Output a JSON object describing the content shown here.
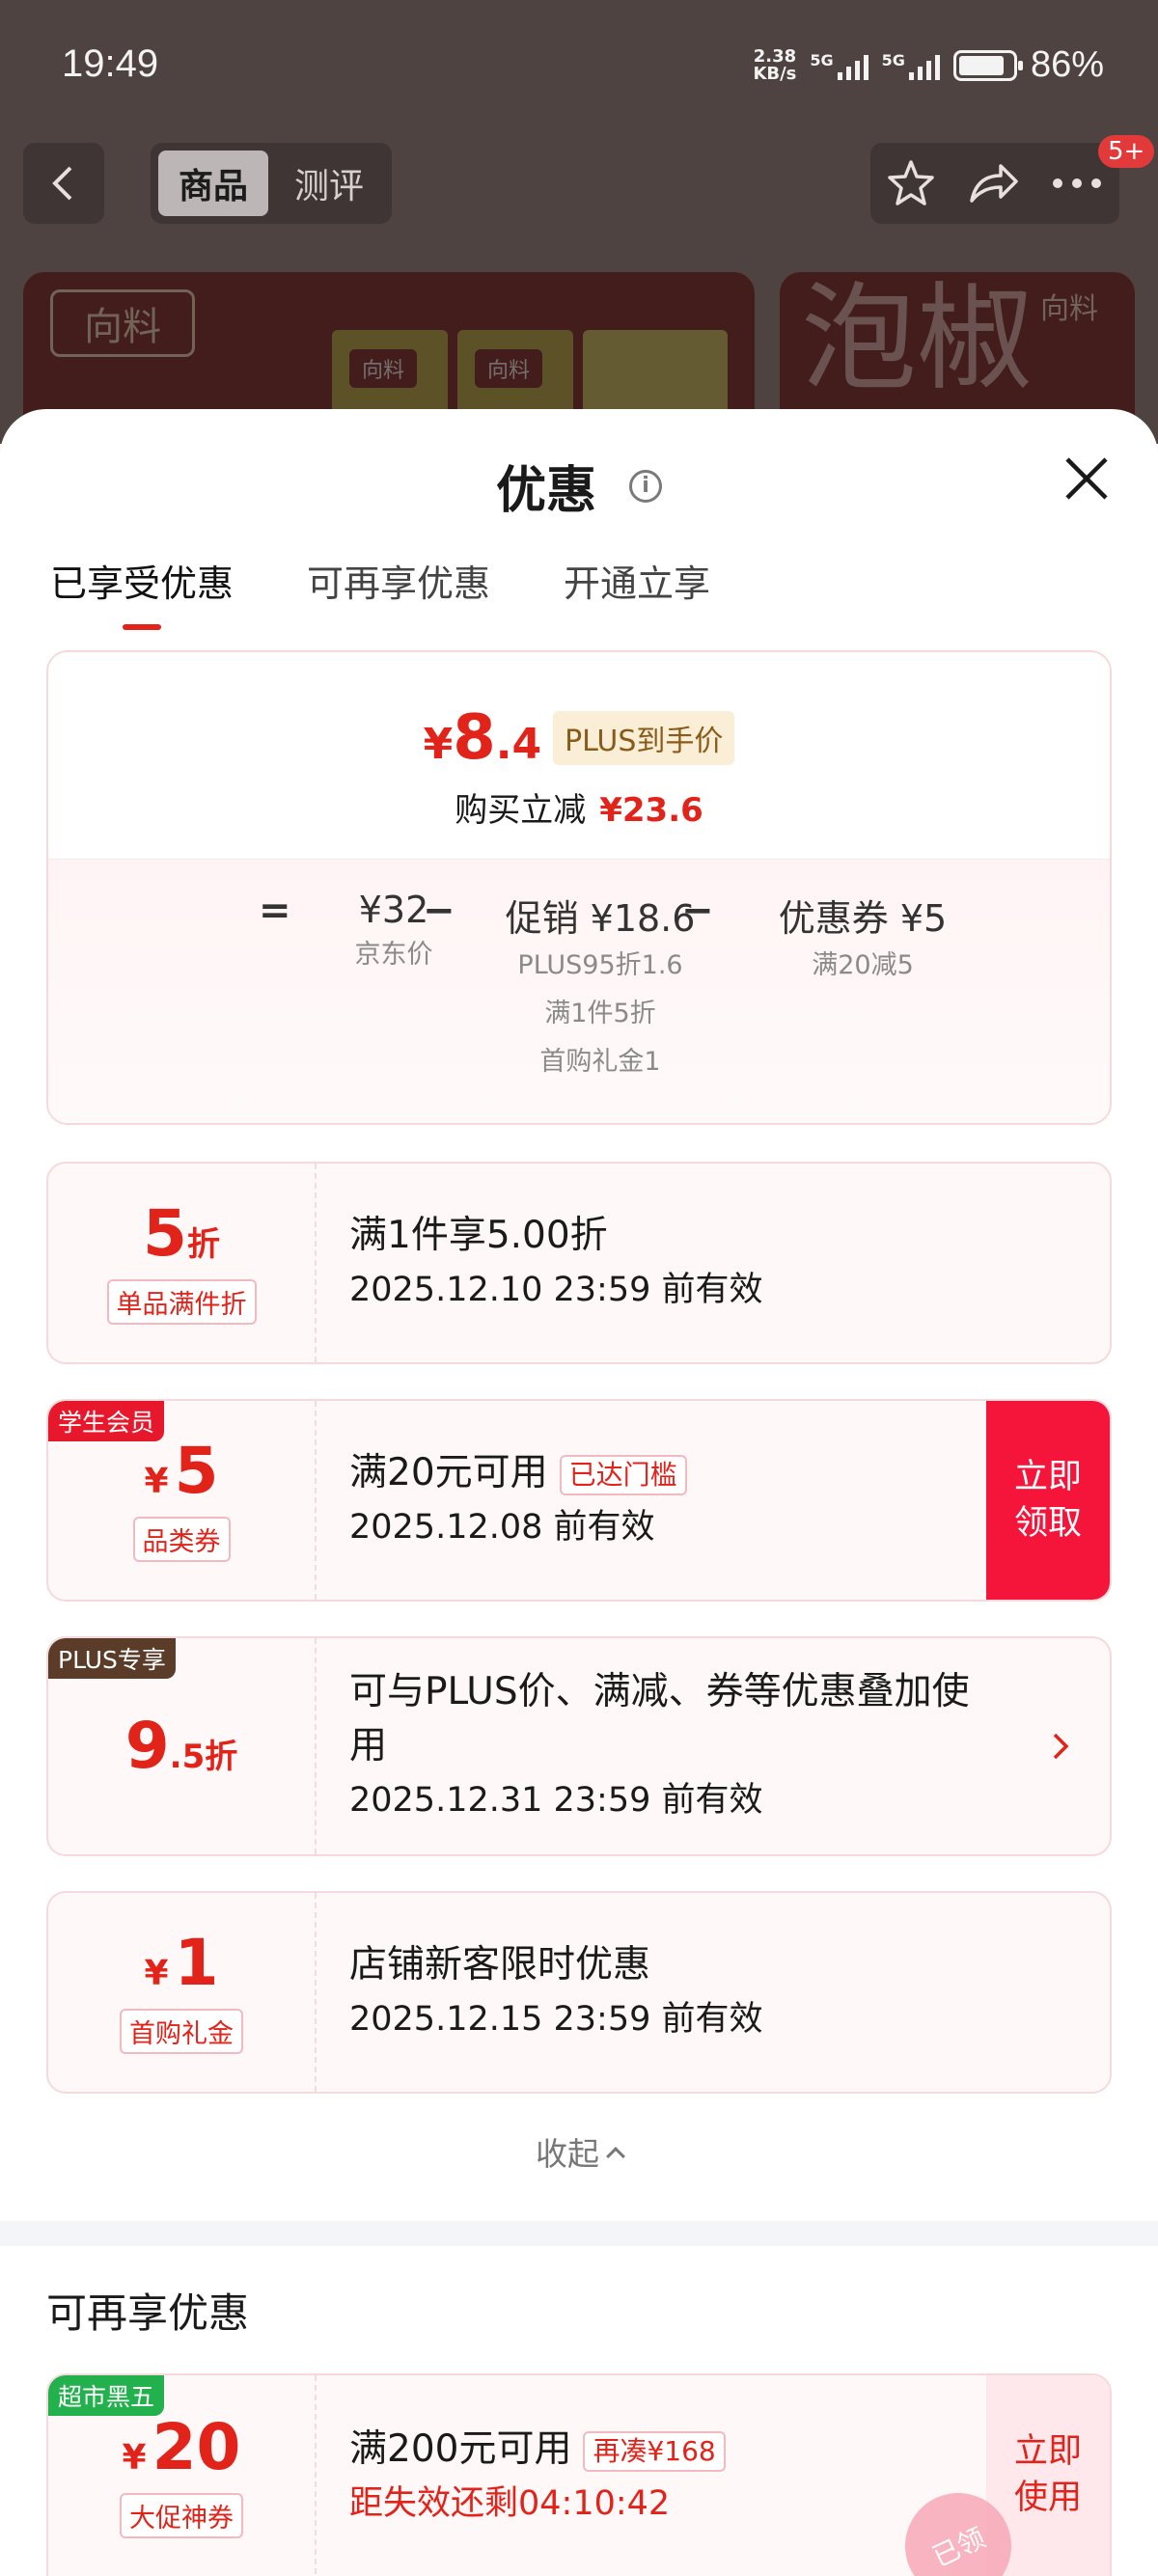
{
  "status_bar": {
    "time": "19:49",
    "net_speed_value": "2.38",
    "net_speed_unit": "KB/s",
    "sig1_label": "5G",
    "sig2_label": "5G",
    "battery_percent": "86%"
  },
  "top_nav": {
    "tabs": [
      "商品",
      "测评"
    ],
    "notification_badge": "5+"
  },
  "products": {
    "brand_left": "向料",
    "brand_right": "向料",
    "pkg_label": "向料",
    "big_char": "泡椒"
  },
  "sheet": {
    "title": "优惠",
    "tabs": [
      "已享受优惠",
      "可再享优惠",
      "开通立享"
    ],
    "summary": {
      "price_symbol": "¥",
      "price_integer": "8",
      "price_decimal": ".4",
      "plus_tag": "PLUS到手价",
      "reduce_label": "购买立减",
      "reduce_amount": "¥23.6",
      "formula": {
        "eq": "=",
        "jd_price": "¥32",
        "jd_price_label": "京东价",
        "minus1": "−",
        "promo": "促销 ¥18.6",
        "promo_details": [
          "PLUS95折1.6",
          "满1件5折",
          "首购礼金1"
        ],
        "minus2": "−",
        "coupon": "优惠券 ¥5",
        "coupon_details": [
          "满20减5"
        ]
      }
    },
    "coupons": [
      {
        "value": "5",
        "unit": "折",
        "type": "单品满件折",
        "title": "满1件享5.00折",
        "date": "2025.12.10 23:59 前有效"
      },
      {
        "corner_tag": "学生会员",
        "currency": "¥",
        "value": "5",
        "type": "品类券",
        "title": "满20元可用",
        "title_tag": "已达门槛",
        "date": "2025.12.08 前有效",
        "button": "立即领取"
      },
      {
        "corner_tag": "PLUS专享",
        "value": "9",
        "value_decimal": ".5",
        "unit": "折",
        "title": "可与PLUS价、满减、券等优惠叠加使用",
        "date": "2025.12.31 23:59 前有效"
      },
      {
        "currency": "¥",
        "value": "1",
        "type": "首购礼金",
        "title": "店铺新客限时优惠",
        "date": "2025.12.15 23:59 前有效"
      }
    ],
    "collapse_label": "收起",
    "more_section_title": "可再享优惠",
    "more_coupons": [
      {
        "corner_tag": "超市黑五",
        "currency": "¥",
        "value": "20",
        "type": "大促神券",
        "title": "满200元可用",
        "title_tag": "再凑¥168",
        "countdown": "距失效还剩04:10:42",
        "button": "立即使用",
        "stamp": "已领"
      }
    ]
  },
  "colors": {
    "accent_red": "#e2231a",
    "claim_red": "#f5143a",
    "student_tag": "#e8182c",
    "plus_tag": "#5a3c28",
    "supermarket_tag": "#23b14d"
  }
}
